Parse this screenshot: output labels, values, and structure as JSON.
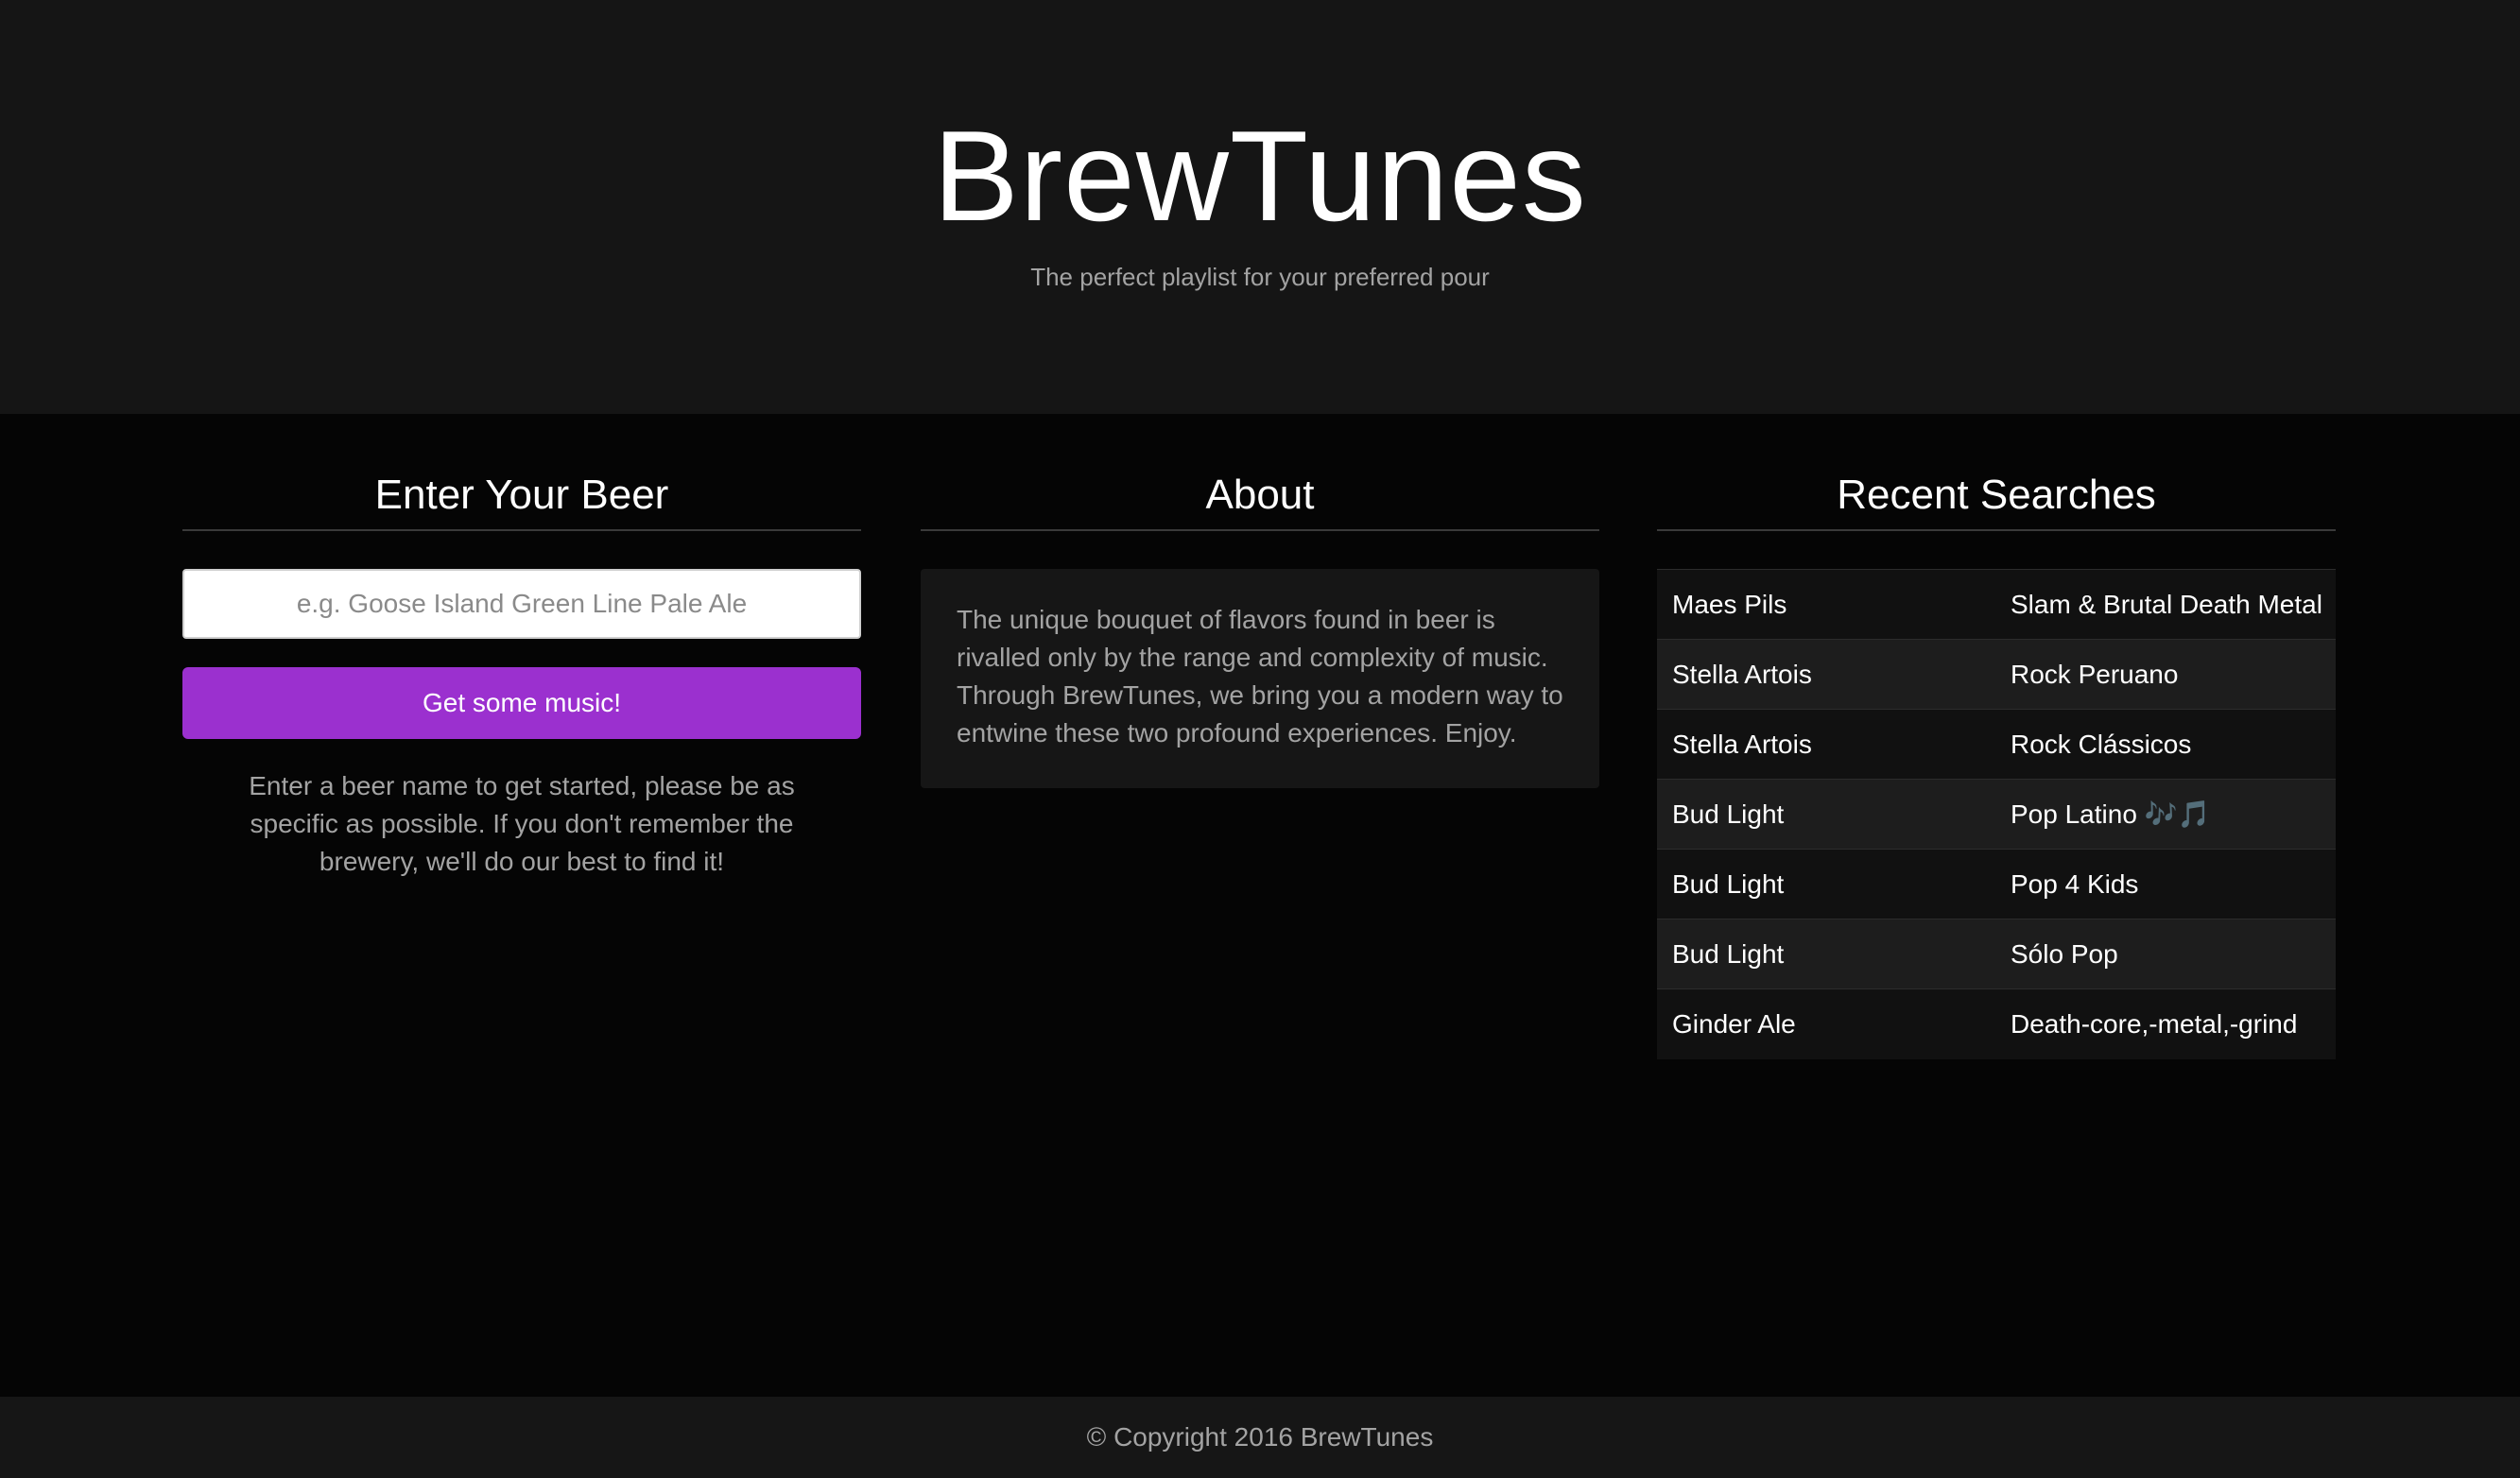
{
  "header": {
    "title": "BrewTunes",
    "tagline": "The perfect playlist for your preferred pour"
  },
  "beer_section": {
    "heading": "Enter Your Beer",
    "input_placeholder": "e.g. Goose Island Green Line Pale Ale",
    "input_value": "",
    "button_label": "Get some music!",
    "help_text": "Enter a beer name to get started, please be as specific as possible. If you don't remember the brewery, we'll do our best to find it!"
  },
  "about_section": {
    "heading": "About",
    "body": "The unique bouquet of flavors found in beer is rivalled only by the range and complexity of music. Through BrewTunes, we bring you a modern way to entwine these two profound experiences. Enjoy."
  },
  "recent_section": {
    "heading": "Recent Searches",
    "rows": [
      {
        "beer": "Maes Pils",
        "genre": "Slam & Brutal Death Metal"
      },
      {
        "beer": "Stella Artois",
        "genre": "Rock Peruano"
      },
      {
        "beer": "Stella Artois",
        "genre": "Rock Clássicos"
      },
      {
        "beer": "Bud Light",
        "genre": "Pop Latino 🎶🎵"
      },
      {
        "beer": "Bud Light",
        "genre": "Pop 4 Kids"
      },
      {
        "beer": "Bud Light",
        "genre": "Sólo Pop"
      },
      {
        "beer": "Ginder Ale",
        "genre": "Death-core,-metal,-grind"
      }
    ]
  },
  "footer": {
    "copyright": "© Copyright 2016 BrewTunes"
  },
  "colors": {
    "accent": "#9b30cf",
    "hero_background": "#151515",
    "page_background": "#050505",
    "muted_text": "#a3a3a3"
  }
}
